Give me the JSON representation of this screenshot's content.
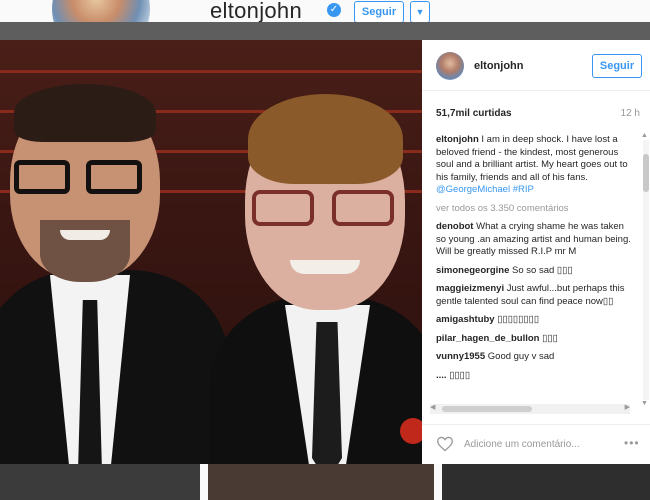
{
  "profile_header": {
    "username": "eltonjohn",
    "verified_icon": "verified-badge-icon",
    "follow_label": "Seguir",
    "dropdown_icon": "caret-down-icon"
  },
  "post": {
    "username": "eltonjohn",
    "follow_label": "Seguir",
    "likes": "51,7mil curtidas",
    "time": "12 h",
    "caption_user": "eltonjohn",
    "caption_text": "I am in deep shock. I have lost a beloved friend - the kindest, most generous soul and a brilliant artist. My heart goes out to his family, friends and all of his fans. ",
    "caption_tags": "@GeorgeMichael #RIP",
    "view_all": "ver todos os 3.350 comentários",
    "comments": [
      {
        "user": "denobot",
        "text": "What a crying shame he was taken so young .an amazing artist and human being. Will be greatly missed R.I.P mr M"
      },
      {
        "user": "simonegeorgine",
        "text": "So so sad ▯▯▯"
      },
      {
        "user": "maggieizmenyi",
        "text": "Just awful...but perhaps this gentle talented soul can find peace now▯▯"
      },
      {
        "user": "amigashtuby",
        "text": "▯▯▯▯▯▯▯▯"
      },
      {
        "user": "pilar_hagen_de_bullon",
        "text": "▯▯▯"
      },
      {
        "user": "vunny1955",
        "text": "Good guy v sad"
      },
      {
        "user": "....",
        "text": "▯▯▯▯"
      }
    ],
    "add_comment_placeholder": "Adicione um comentário...",
    "more_icon": "more-options-icon",
    "heart_icon": "heart-icon"
  }
}
